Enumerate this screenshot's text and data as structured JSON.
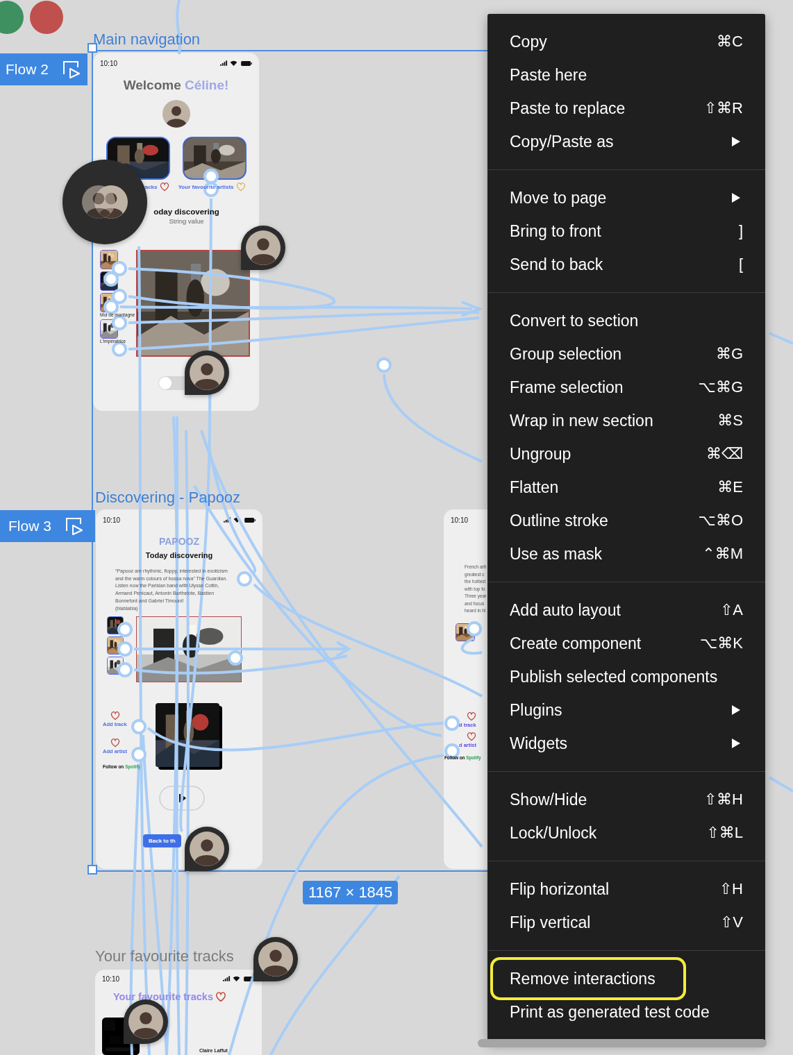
{
  "window_controls": [
    {
      "color": "#3f9060"
    },
    {
      "color": "#c0504d"
    }
  ],
  "canvas": {
    "frames": [
      {
        "label": "Main navigation",
        "flow": "Flow 2",
        "phone": {
          "kind": "home",
          "time": "10:10",
          "greeting": "Welcome",
          "name": "Céline!",
          "cards": [
            {
              "caption": "racks"
            },
            {
              "caption": "Your favourite artists"
            }
          ],
          "section_title": "oday discovering",
          "section_value": "String value",
          "tracks": [
            {
              "kind": "thumbnail"
            },
            {
              "kind": "thumbnail"
            },
            {
              "kind": "thumbnail",
              "caption": "Moi de montagne"
            },
            {
              "kind": "thumbnail",
              "caption": "L'impératrice"
            }
          ],
          "toggle": {
            "on": false
          }
        }
      },
      {
        "label": "Discovering - Papooz",
        "flow": "Flow 3",
        "phone": {
          "kind": "artist",
          "time": "10:10",
          "brand": "PAPOOZ",
          "title": "Today discovering",
          "description": "“Papooz are rhythmic, floppy, interested in exoticism and the warm colours of bossa nova” The Guardian.\nListen now the Parisian band with Ulysse Cottin, Armand Penicaut, Antonin Barthelote, Bastien Bonnefont and Gabriel Timouni!\n(blablabla)",
          "actions": [
            {
              "label": "Add track"
            },
            {
              "label": "Add artist"
            }
          ],
          "follow": "Follow on",
          "service": "Spotify",
          "button": "Back to th"
        }
      },
      {
        "phone": {
          "kind": "artist_partial",
          "time": "10:10",
          "description_lines": [
            "French arti",
            "greatest c",
            "the hottest",
            "with top fo",
            "Three year",
            "and focus",
            "heard in hi"
          ],
          "actions": [
            {
              "label": "d track"
            },
            {
              "label": "d artist"
            }
          ],
          "follow": "Follow on",
          "service": "Spotify"
        }
      },
      {
        "label": "Your favourite tracks",
        "phone": {
          "kind": "tracks",
          "time": "10:10",
          "title": "Your favourite tracks",
          "artist": "Claire Laffut"
        }
      }
    ],
    "selection": {
      "dimensions": "1167 × 1845"
    },
    "collaborator_cursors": [
      {
        "kind": "large"
      },
      {
        "kind": "pin"
      },
      {
        "kind": "pin"
      },
      {
        "kind": "pin"
      },
      {
        "kind": "pin"
      },
      {
        "kind": "pin"
      }
    ]
  },
  "context_menu": {
    "groups": [
      [
        {
          "label": "Copy",
          "shortcut": "⌘C",
          "submenu": false,
          "highlighted": false
        },
        {
          "label": "Paste here",
          "submenu": false,
          "highlighted": false
        },
        {
          "label": "Paste to replace",
          "shortcut": "⇧⌘R",
          "submenu": false,
          "highlighted": false
        },
        {
          "label": "Copy/Paste as",
          "submenu": true,
          "highlighted": false
        }
      ],
      [
        {
          "label": "Move to page",
          "submenu": true,
          "highlighted": false
        },
        {
          "label": "Bring to front",
          "shortcut": "]",
          "submenu": false,
          "highlighted": false
        },
        {
          "label": "Send to back",
          "shortcut": "[",
          "submenu": false,
          "highlighted": false
        }
      ],
      [
        {
          "label": "Convert to section",
          "submenu": false,
          "highlighted": false
        },
        {
          "label": "Group selection",
          "shortcut": "⌘G",
          "submenu": false,
          "highlighted": false
        },
        {
          "label": "Frame selection",
          "shortcut": "⌥⌘G",
          "submenu": false,
          "highlighted": false
        },
        {
          "label": "Wrap in new section",
          "shortcut": "⌘S",
          "submenu": false,
          "highlighted": false
        },
        {
          "label": "Ungroup",
          "shortcut": "⌘⌫",
          "submenu": false,
          "highlighted": false
        },
        {
          "label": "Flatten",
          "shortcut": "⌘E",
          "submenu": false,
          "highlighted": false
        },
        {
          "label": "Outline stroke",
          "shortcut": "⌥⌘O",
          "submenu": false,
          "highlighted": false
        },
        {
          "label": "Use as mask",
          "shortcut": "⌃⌘M",
          "submenu": false,
          "highlighted": false
        }
      ],
      [
        {
          "label": "Add auto layout",
          "shortcut": "⇧A",
          "submenu": false,
          "highlighted": false
        },
        {
          "label": "Create component",
          "shortcut": "⌥⌘K",
          "submenu": false,
          "highlighted": false
        },
        {
          "label": "Publish selected components",
          "submenu": false,
          "highlighted": false
        },
        {
          "label": "Plugins",
          "submenu": true,
          "highlighted": false
        },
        {
          "label": "Widgets",
          "submenu": true,
          "highlighted": false
        }
      ],
      [
        {
          "label": "Show/Hide",
          "shortcut": "⇧⌘H",
          "submenu": false,
          "highlighted": false
        },
        {
          "label": "Lock/Unlock",
          "shortcut": "⇧⌘L",
          "submenu": false,
          "highlighted": false
        }
      ],
      [
        {
          "label": "Flip horizontal",
          "shortcut": "⇧H",
          "submenu": false,
          "highlighted": false
        },
        {
          "label": "Flip vertical",
          "shortcut": "⇧V",
          "submenu": false,
          "highlighted": false
        }
      ],
      [
        {
          "label": "Remove interactions",
          "submenu": false,
          "highlighted": true
        },
        {
          "label": "Print as generated test code",
          "submenu": false,
          "highlighted": false
        }
      ]
    ]
  }
}
